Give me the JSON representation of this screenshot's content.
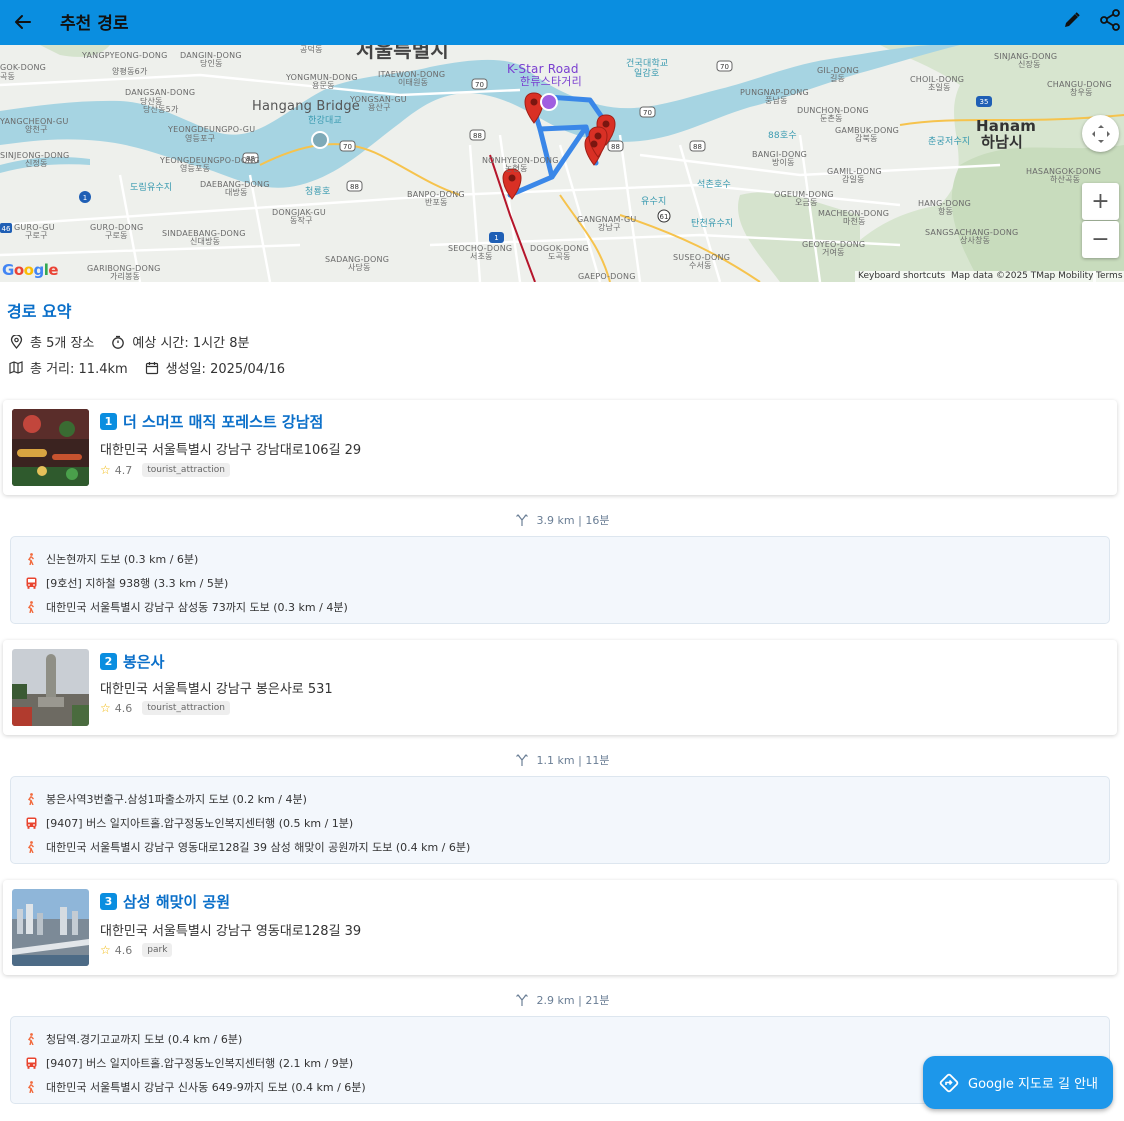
{
  "appbar": {
    "title": "추천 경로",
    "back_icon": "arrow-left-icon",
    "edit_icon": "pencil-icon",
    "share_icon": "share-icon"
  },
  "map": {
    "labels": {
      "gokdong": "GOK-DONG",
      "gokdong_ko": "곡동",
      "yangpyeong": "YANGPYEONG-DONG",
      "yangpyeong_ko": "양평동6가",
      "dangin": "DANGIN-DONG",
      "dangin_ko": "당인동",
      "dangsan": "DANGSAN-DONG",
      "dangsan_ko": "당산동",
      "dangsan5": "당산동5가",
      "yangcheon": "YANGCHEON-GU",
      "yangcheon_ko": "양천구",
      "yeongdeungpogu": "YEONGDEUNGPO-GU",
      "yeongdeungpogu_ko": "영등포구",
      "sinjeong": "SINJEONG-DONG",
      "sinjeong_ko": "신정동",
      "yeongdeungpodong": "YEONGDEUNGPO-DONG",
      "yeongdeungpodong_ko": "영등포동",
      "dorim": "도림유수지",
      "daebang": "DAEBANG-DONG",
      "daebang_ko": "대방동",
      "gurogu_short": "GURO-GU",
      "gurogu_ko": "구로구",
      "gurodong": "GURO-DONG",
      "gurodong_ko": "구로동",
      "sindaebang": "SINDAEBANG-DONG",
      "sindaebang_ko": "신대방동",
      "garibong": "GARIBONG-DONG",
      "garibong_ko": "가리봉동",
      "gongdeok": "공덕동",
      "seoul": "서울특별시",
      "yongmun": "YONGMUN-DONG",
      "yongmun_ko": "용문동",
      "itaewon": "ITAEWON-DONG",
      "itaewon_ko": "이태원동",
      "yongsan": "YONGSAN-GU",
      "yongsan_ko": "용산구",
      "hangangbridge": "Hangang Bridge",
      "hangangbridge_ko": "한강대교",
      "cheongnyong": "청룡호",
      "dongjak": "DONGJAK-GU",
      "dongjak_ko": "동작구",
      "banpo": "BANPO-DONG",
      "banpo_ko": "반포동",
      "sadang": "SADANG-DONG",
      "sadang_ko": "사당동",
      "seocho": "SEOCHO-DONG",
      "seocho_ko": "서초동",
      "nonhyeon": "NONHYEON-DONG",
      "nonhyeon_ko": "논현동",
      "gangnamgu": "GANGNAM-GU",
      "gangnamgu_ko": "강남구",
      "dogok": "DOGOK-DONG",
      "dogok_ko": "도곡동",
      "gaepo": "GAEPO-DONG",
      "kstar": "K-Star Road",
      "kstar_ko": "한류스타거리",
      "konkuk": "건국대학교",
      "ilgamho": "일감호",
      "yusuji": "유수지",
      "seokchonho": "석촌호수",
      "tancheon": "탄천유수지",
      "suseo": "SUSEO-DONG",
      "suseo_ko": "수서동",
      "pungnap": "PUNGNAP-DONG",
      "pungnap_ko": "풍납동",
      "gildong": "GIL-DONG",
      "gildong_ko": "길동",
      "dunchon": "DUNCHON-DONG",
      "dunchon_ko": "둔촌동",
      "hosu88": "88호수",
      "bangi": "BANGI-DONG",
      "bangi_ko": "방이동",
      "gambuk": "GAMBUK-DONG",
      "gambuk_ko": "감북동",
      "gamil": "GAMIL-DONG",
      "gamil_ko": "감일동",
      "ogeum": "OGEUM-DONG",
      "ogeum_ko": "오금동",
      "macheon": "MACHEON-DONG",
      "macheon_ko": "마천동",
      "geoyeo": "GEOYEO-DONG",
      "geoyeo_ko": "거여동",
      "choil": "CHOIL-DONG",
      "choil_ko": "초일동",
      "chunggung": "춘궁저수지",
      "hanam": "Hanam",
      "hanam_ko": "하남시",
      "hangdong": "HANG-DONG",
      "hangdong_ko": "항동",
      "sangsachang": "SANGSACHANG-DONG",
      "sangsachang_ko": "상사창동",
      "hasangok": "HASANGOK-DONG",
      "hasangok_ko": "하산곡동",
      "sinjang": "SINJANG-DONG",
      "sinjang_ko": "신장동",
      "changu": "CHANGU-DONG",
      "changu_ko": "창우동"
    },
    "route_shields": [
      "70",
      "70",
      "70",
      "88",
      "88",
      "88",
      "88",
      "70",
      "88",
      "1",
      "61",
      "1",
      "35",
      "46"
    ],
    "google_logo": "Google",
    "attribution": {
      "shortcuts": "Keyboard shortcuts",
      "data": "Map data ©2025 TMap Mobility",
      "terms": "Terms"
    },
    "controls": {
      "recenter_icon": "pan-arrows-icon",
      "zoom_in": "+",
      "zoom_out": "−"
    }
  },
  "summary": {
    "title": "경로 요약",
    "places": "총 5개 장소",
    "time": "예상 시간: 1시간 8분",
    "distance": "총 거리: 11.4km",
    "created": "생성일: 2025/04/16"
  },
  "places": [
    {
      "index": "1",
      "name": "더 스머프 매직 포레스트 강남점",
      "address": "대한민국 서울특별시 강남구 강남대로106길 29",
      "rating": "4.7",
      "type": "tourist_attraction"
    },
    {
      "index": "2",
      "name": "봉은사",
      "address": "대한민국 서울특별시 강남구 봉은사로 531",
      "rating": "4.6",
      "type": "tourist_attraction"
    },
    {
      "index": "3",
      "name": "삼성 해맞이 공원",
      "address": "대한민국 서울특별시 강남구 영동대로128길 39",
      "rating": "4.6",
      "type": "park"
    }
  ],
  "segments": [
    {
      "summary": "3.9 km | 16분",
      "steps": [
        {
          "mode": "walk",
          "text": "신논현까지 도보 (0.3 km / 6분)"
        },
        {
          "mode": "transit",
          "text": "[9호선] 지하철 938행 (3.3 km / 5분)"
        },
        {
          "mode": "walk",
          "text": "대한민국 서울특별시 강남구 삼성동 73까지 도보 (0.3 km / 4분)"
        }
      ]
    },
    {
      "summary": "1.1 km | 11분",
      "steps": [
        {
          "mode": "walk",
          "text": "봉은사역3번출구.삼성1파출소까지 도보 (0.2 km / 4분)"
        },
        {
          "mode": "transit",
          "text": "[9407] 버스 일지아트홀.압구정동노인복지센터행 (0.5 km / 1분)"
        },
        {
          "mode": "walk",
          "text": "대한민국 서울특별시 강남구 영동대로128길 39 삼성 해맞이 공원까지 도보 (0.4 km / 6분)"
        }
      ]
    },
    {
      "summary": "2.9 km | 21분",
      "steps": [
        {
          "mode": "walk",
          "text": "청담역.경기고교까지 도보 (0.4 km / 6분)"
        },
        {
          "mode": "transit",
          "text": "[9407] 버스 일지아트홀.압구정동노인복지센터행 (2.1 km / 9분)"
        },
        {
          "mode": "walk",
          "text": "대한민국 서울특별시 강남구 신사동 649-9까지 도보 (0.4 km / 6분)"
        }
      ]
    }
  ],
  "fab": {
    "label": "Google 지도로 길 안내",
    "icon": "directions-icon"
  },
  "colors": {
    "appbar": "#0a8ee0",
    "accent": "#0a6fc9",
    "walk": "#f26a3d",
    "transit": "#e8442f",
    "route": "#3a87e8",
    "marker": "#d93025"
  }
}
